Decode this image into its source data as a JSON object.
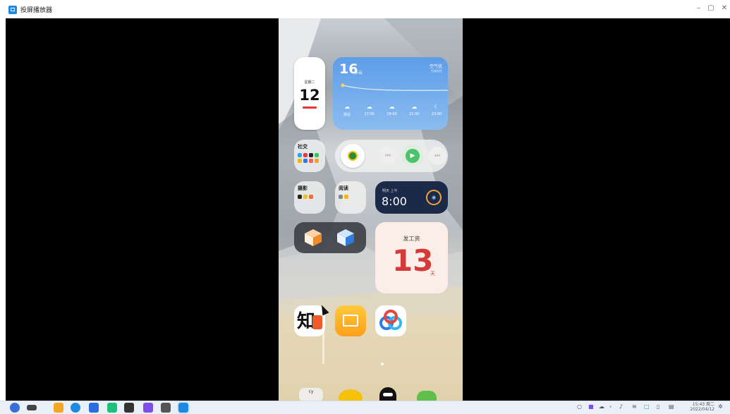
{
  "window": {
    "title": "投屏播放器",
    "controls": [
      "–",
      "▢",
      "✕"
    ]
  },
  "phone": {
    "calendar": {
      "weekday": "星期二",
      "day": "12"
    },
    "weather": {
      "temp": "16",
      "unit": "°",
      "condition": "多云",
      "air": "空气优",
      "air_sub": "空调无忧",
      "hours": [
        {
          "time": "现在",
          "icon": "☁"
        },
        {
          "time": "17:00",
          "icon": "☁"
        },
        {
          "time": "19:00",
          "icon": "☁"
        },
        {
          "time": "21:00",
          "icon": "☁"
        },
        {
          "time": "23:00",
          "icon": "☾"
        }
      ]
    },
    "social": {
      "label": "社交"
    },
    "music": {
      "prev": "⏮",
      "play": "▶",
      "next": "⏭"
    },
    "photo": {
      "label": "摄影"
    },
    "reading": {
      "label": "阅读"
    },
    "alarm": {
      "subtitle": "明天 上午",
      "time": "8:00"
    },
    "payday": {
      "label": "发工资",
      "days": "13",
      "unit": "天"
    },
    "apps": {
      "zhihu_char": "知"
    },
    "dock": {
      "cy_label": "cy"
    }
  },
  "taskbar": {
    "time": "15:43 周二",
    "date": "2022/04/12"
  },
  "colors": {
    "accent": "#1e88e5",
    "payday_red": "#d43a3a",
    "weather_blue": "#5d9de8"
  }
}
